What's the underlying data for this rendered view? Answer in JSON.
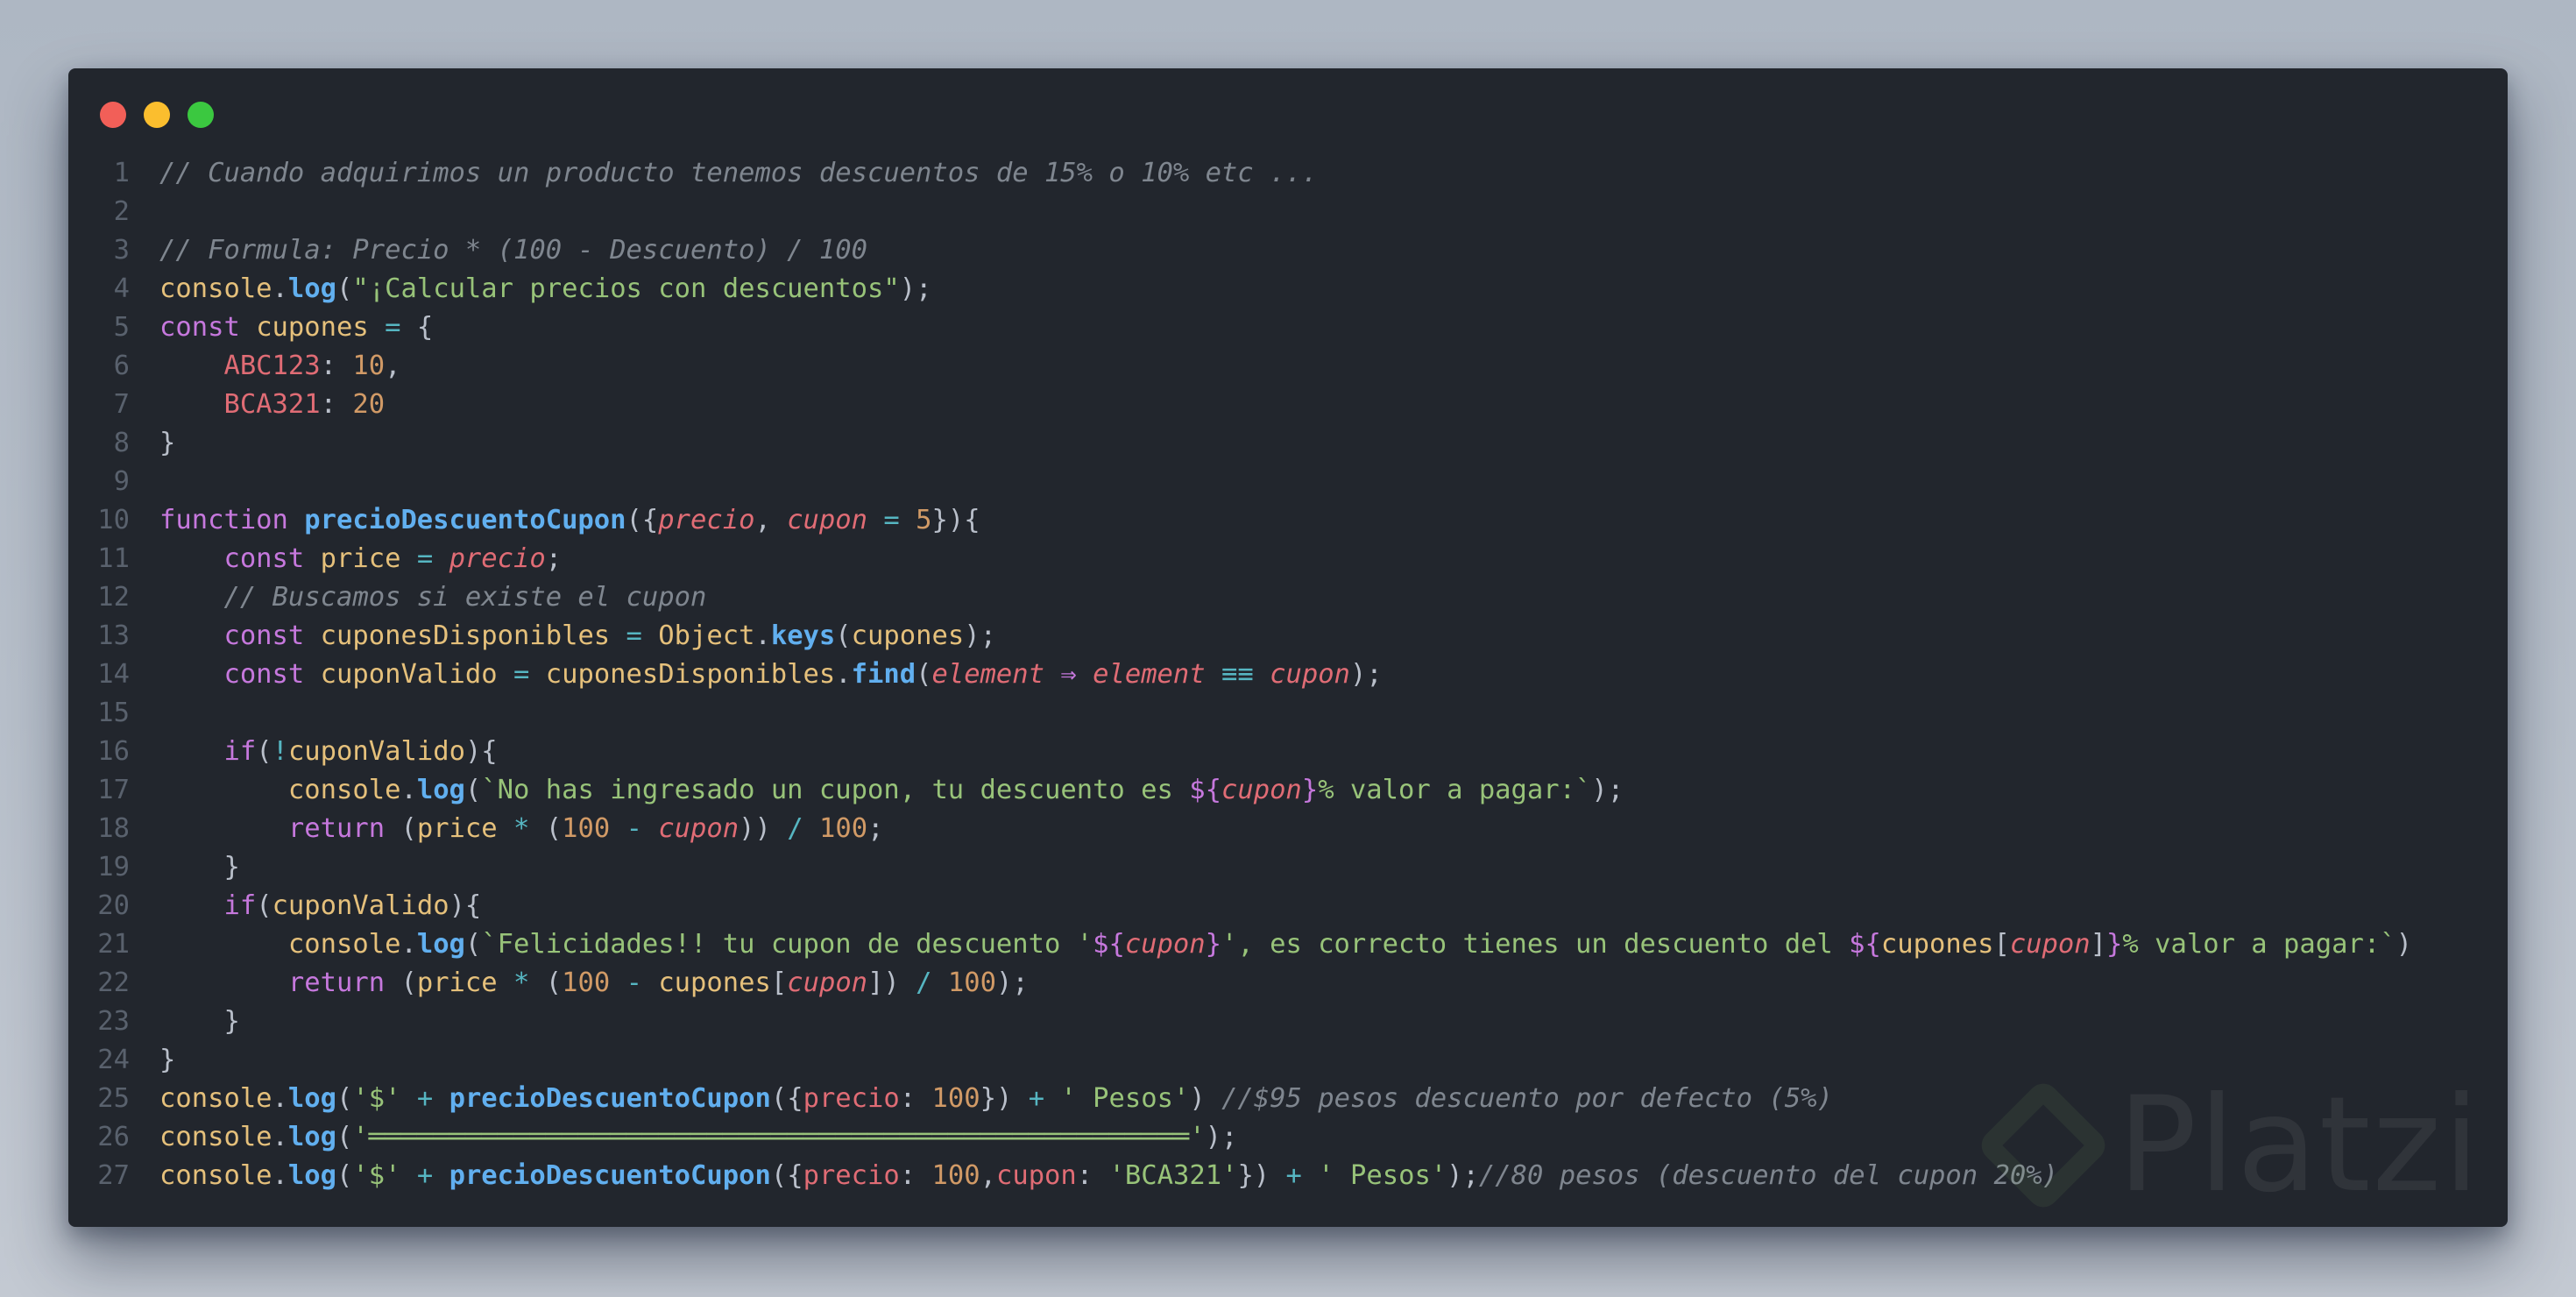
{
  "window": {
    "controls": [
      {
        "name": "close-dot",
        "color": "#f25f58"
      },
      {
        "name": "minimize-dot",
        "color": "#fbbe2e"
      },
      {
        "name": "zoom-dot",
        "color": "#3bc840"
      }
    ]
  },
  "colors": {
    "background": "#22262d",
    "comment": "#7f868f",
    "keyword": "#c678dd",
    "variable": "#e5c07b",
    "function": "#61afef",
    "string": "#98c379",
    "number": "#d19a66",
    "property": "#e06c75",
    "operator": "#56b6c2"
  },
  "code_lines": [
    {
      "n": "1",
      "tokens": [
        {
          "t": "// Cuando adquirimos un producto tenemos descuentos de 15% o 10% etc ...",
          "c": "com"
        }
      ]
    },
    {
      "n": "2",
      "tokens": []
    },
    {
      "n": "3",
      "tokens": [
        {
          "t": "// Formula: Precio * (100 - Descuento) / 100",
          "c": "com"
        }
      ]
    },
    {
      "n": "4",
      "tokens": [
        {
          "t": "console",
          "c": "var"
        },
        {
          "t": ".",
          "c": "pun"
        },
        {
          "t": "log",
          "c": "fn"
        },
        {
          "t": "(",
          "c": "pun"
        },
        {
          "t": "\"¡Calcular precios con descuentos\"",
          "c": "str"
        },
        {
          "t": ");",
          "c": "pun"
        }
      ]
    },
    {
      "n": "5",
      "tokens": [
        {
          "t": "const ",
          "c": "kw"
        },
        {
          "t": "cupones",
          "c": "var"
        },
        {
          "t": " = ",
          "c": "op"
        },
        {
          "t": "{",
          "c": "pun"
        }
      ]
    },
    {
      "n": "6",
      "tokens": [
        {
          "t": "    ",
          "c": "pun"
        },
        {
          "t": "ABC123",
          "c": "prop"
        },
        {
          "t": ": ",
          "c": "pun"
        },
        {
          "t": "10",
          "c": "num"
        },
        {
          "t": ",",
          "c": "pun"
        }
      ]
    },
    {
      "n": "7",
      "tokens": [
        {
          "t": "    ",
          "c": "pun"
        },
        {
          "t": "BCA321",
          "c": "prop"
        },
        {
          "t": ": ",
          "c": "pun"
        },
        {
          "t": "20",
          "c": "num"
        }
      ]
    },
    {
      "n": "8",
      "tokens": [
        {
          "t": "}",
          "c": "pun"
        }
      ]
    },
    {
      "n": "9",
      "tokens": []
    },
    {
      "n": "10",
      "tokens": [
        {
          "t": "function ",
          "c": "kw"
        },
        {
          "t": "precioDescuentoCupon",
          "c": "fn"
        },
        {
          "t": "({",
          "c": "pun"
        },
        {
          "t": "precio",
          "c": "pi"
        },
        {
          "t": ", ",
          "c": "pun"
        },
        {
          "t": "cupon",
          "c": "pi"
        },
        {
          "t": " = ",
          "c": "op"
        },
        {
          "t": "5",
          "c": "num"
        },
        {
          "t": "}){",
          "c": "pun"
        }
      ]
    },
    {
      "n": "11",
      "tokens": [
        {
          "t": "    ",
          "c": "pun"
        },
        {
          "t": "const ",
          "c": "kw"
        },
        {
          "t": "price",
          "c": "var"
        },
        {
          "t": " = ",
          "c": "op"
        },
        {
          "t": "precio",
          "c": "pi"
        },
        {
          "t": ";",
          "c": "pun"
        }
      ]
    },
    {
      "n": "12",
      "tokens": [
        {
          "t": "    ",
          "c": "pun"
        },
        {
          "t": "// Buscamos si existe el cupon",
          "c": "com"
        }
      ]
    },
    {
      "n": "13",
      "tokens": [
        {
          "t": "    ",
          "c": "pun"
        },
        {
          "t": "const ",
          "c": "kw"
        },
        {
          "t": "cuponesDisponibles",
          "c": "var"
        },
        {
          "t": " = ",
          "c": "op"
        },
        {
          "t": "Object",
          "c": "var"
        },
        {
          "t": ".",
          "c": "pun"
        },
        {
          "t": "keys",
          "c": "fn"
        },
        {
          "t": "(",
          "c": "pun"
        },
        {
          "t": "cupones",
          "c": "var"
        },
        {
          "t": ");",
          "c": "pun"
        }
      ]
    },
    {
      "n": "14",
      "tokens": [
        {
          "t": "    ",
          "c": "pun"
        },
        {
          "t": "const ",
          "c": "kw"
        },
        {
          "t": "cuponValido",
          "c": "var"
        },
        {
          "t": " = ",
          "c": "op"
        },
        {
          "t": "cuponesDisponibles",
          "c": "var"
        },
        {
          "t": ".",
          "c": "pun"
        },
        {
          "t": "find",
          "c": "fn"
        },
        {
          "t": "(",
          "c": "pun"
        },
        {
          "t": "element",
          "c": "pi"
        },
        {
          "t": " ⇒ ",
          "c": "kw"
        },
        {
          "t": "element",
          "c": "pi"
        },
        {
          "t": " ≡≡ ",
          "c": "op"
        },
        {
          "t": "cupon",
          "c": "pi"
        },
        {
          "t": ");",
          "c": "pun"
        }
      ]
    },
    {
      "n": "15",
      "tokens": []
    },
    {
      "n": "16",
      "tokens": [
        {
          "t": "    ",
          "c": "pun"
        },
        {
          "t": "if",
          "c": "kw"
        },
        {
          "t": "(",
          "c": "pun"
        },
        {
          "t": "!",
          "c": "op"
        },
        {
          "t": "cuponValido",
          "c": "var"
        },
        {
          "t": "){",
          "c": "pun"
        }
      ]
    },
    {
      "n": "17",
      "tokens": [
        {
          "t": "        ",
          "c": "pun"
        },
        {
          "t": "console",
          "c": "var"
        },
        {
          "t": ".",
          "c": "pun"
        },
        {
          "t": "log",
          "c": "fn"
        },
        {
          "t": "(",
          "c": "pun"
        },
        {
          "t": "`No has ingresado un cupon, tu descuento es ",
          "c": "str"
        },
        {
          "t": "${",
          "c": "interp"
        },
        {
          "t": "cupon",
          "c": "pi"
        },
        {
          "t": "}",
          "c": "interp"
        },
        {
          "t": "% valor a pagar:`",
          "c": "str"
        },
        {
          "t": ");",
          "c": "pun"
        }
      ]
    },
    {
      "n": "18",
      "tokens": [
        {
          "t": "        ",
          "c": "pun"
        },
        {
          "t": "return ",
          "c": "kw"
        },
        {
          "t": "(",
          "c": "pun"
        },
        {
          "t": "price",
          "c": "var"
        },
        {
          "t": " * ",
          "c": "op"
        },
        {
          "t": "(",
          "c": "pun"
        },
        {
          "t": "100",
          "c": "num"
        },
        {
          "t": " - ",
          "c": "op"
        },
        {
          "t": "cupon",
          "c": "pi"
        },
        {
          "t": "))",
          "c": "pun"
        },
        {
          "t": " / ",
          "c": "op"
        },
        {
          "t": "100",
          "c": "num"
        },
        {
          "t": ";",
          "c": "pun"
        }
      ]
    },
    {
      "n": "19",
      "tokens": [
        {
          "t": "    }",
          "c": "pun"
        }
      ]
    },
    {
      "n": "20",
      "tokens": [
        {
          "t": "    ",
          "c": "pun"
        },
        {
          "t": "if",
          "c": "kw"
        },
        {
          "t": "(",
          "c": "pun"
        },
        {
          "t": "cuponValido",
          "c": "var"
        },
        {
          "t": "){",
          "c": "pun"
        }
      ]
    },
    {
      "n": "21",
      "tokens": [
        {
          "t": "        ",
          "c": "pun"
        },
        {
          "t": "console",
          "c": "var"
        },
        {
          "t": ".",
          "c": "pun"
        },
        {
          "t": "log",
          "c": "fn"
        },
        {
          "t": "(",
          "c": "pun"
        },
        {
          "t": "`Felicidades!! tu cupon de descuento '",
          "c": "str"
        },
        {
          "t": "${",
          "c": "interp"
        },
        {
          "t": "cupon",
          "c": "pi"
        },
        {
          "t": "}",
          "c": "interp"
        },
        {
          "t": "', es correcto tienes un descuento del ",
          "c": "str"
        },
        {
          "t": "${",
          "c": "interp"
        },
        {
          "t": "cupones",
          "c": "var"
        },
        {
          "t": "[",
          "c": "pun"
        },
        {
          "t": "cupon",
          "c": "pi"
        },
        {
          "t": "]",
          "c": "pun"
        },
        {
          "t": "}",
          "c": "interp"
        },
        {
          "t": "% valor a pagar:`",
          "c": "str"
        },
        {
          "t": ")",
          "c": "pun"
        }
      ]
    },
    {
      "n": "22",
      "tokens": [
        {
          "t": "        ",
          "c": "pun"
        },
        {
          "t": "return ",
          "c": "kw"
        },
        {
          "t": "(",
          "c": "pun"
        },
        {
          "t": "price",
          "c": "var"
        },
        {
          "t": " * ",
          "c": "op"
        },
        {
          "t": "(",
          "c": "pun"
        },
        {
          "t": "100",
          "c": "num"
        },
        {
          "t": " - ",
          "c": "op"
        },
        {
          "t": "cupones",
          "c": "var"
        },
        {
          "t": "[",
          "c": "pun"
        },
        {
          "t": "cupon",
          "c": "pi"
        },
        {
          "t": "])",
          "c": "pun"
        },
        {
          "t": " / ",
          "c": "op"
        },
        {
          "t": "100",
          "c": "num"
        },
        {
          "t": ");",
          "c": "pun"
        }
      ]
    },
    {
      "n": "23",
      "tokens": [
        {
          "t": "    }",
          "c": "pun"
        }
      ]
    },
    {
      "n": "24",
      "tokens": [
        {
          "t": "}",
          "c": "pun"
        }
      ]
    },
    {
      "n": "25",
      "tokens": [
        {
          "t": "console",
          "c": "var"
        },
        {
          "t": ".",
          "c": "pun"
        },
        {
          "t": "log",
          "c": "fn"
        },
        {
          "t": "(",
          "c": "pun"
        },
        {
          "t": "'$'",
          "c": "str"
        },
        {
          "t": " + ",
          "c": "op"
        },
        {
          "t": "precioDescuentoCupon",
          "c": "fn"
        },
        {
          "t": "({",
          "c": "pun"
        },
        {
          "t": "precio",
          "c": "prop"
        },
        {
          "t": ": ",
          "c": "pun"
        },
        {
          "t": "100",
          "c": "num"
        },
        {
          "t": "})",
          "c": "pun"
        },
        {
          "t": " + ",
          "c": "op"
        },
        {
          "t": "' Pesos'",
          "c": "str"
        },
        {
          "t": ") ",
          "c": "pun"
        },
        {
          "t": "//$95 pesos descuento por defecto (5%)",
          "c": "com"
        }
      ]
    },
    {
      "n": "26",
      "tokens": [
        {
          "t": "console",
          "c": "var"
        },
        {
          "t": ".",
          "c": "pun"
        },
        {
          "t": "log",
          "c": "fn"
        },
        {
          "t": "(",
          "c": "pun"
        },
        {
          "t": "'═══════════════════════════════════════════════════'",
          "c": "str"
        },
        {
          "t": ");",
          "c": "pun"
        }
      ]
    },
    {
      "n": "27",
      "tokens": [
        {
          "t": "console",
          "c": "var"
        },
        {
          "t": ".",
          "c": "pun"
        },
        {
          "t": "log",
          "c": "fn"
        },
        {
          "t": "(",
          "c": "pun"
        },
        {
          "t": "'$'",
          "c": "str"
        },
        {
          "t": " + ",
          "c": "op"
        },
        {
          "t": "precioDescuentoCupon",
          "c": "fn"
        },
        {
          "t": "({",
          "c": "pun"
        },
        {
          "t": "precio",
          "c": "prop"
        },
        {
          "t": ": ",
          "c": "pun"
        },
        {
          "t": "100",
          "c": "num"
        },
        {
          "t": ",",
          "c": "pun"
        },
        {
          "t": "cupon",
          "c": "prop"
        },
        {
          "t": ": ",
          "c": "pun"
        },
        {
          "t": "'BCA321'",
          "c": "str"
        },
        {
          "t": "})",
          "c": "pun"
        },
        {
          "t": " + ",
          "c": "op"
        },
        {
          "t": "' Pesos'",
          "c": "str"
        },
        {
          "t": ");",
          "c": "pun"
        },
        {
          "t": "//80 pesos (descuento del cupon 20%)",
          "c": "com"
        }
      ]
    }
  ],
  "watermark": {
    "brand": "Platzi",
    "icon": "platzi-logo-icon"
  }
}
